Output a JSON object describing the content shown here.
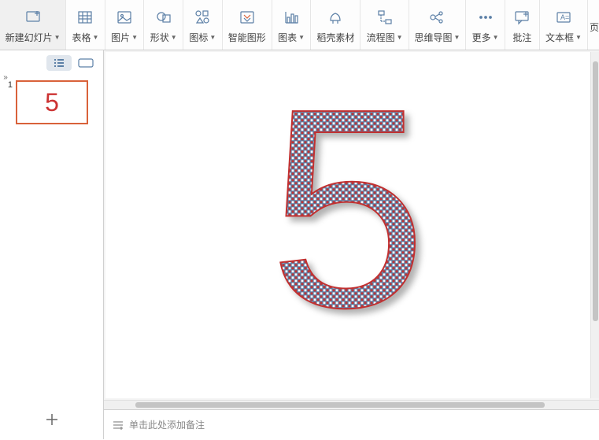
{
  "toolbar": {
    "items": [
      {
        "label": "新建幻灯片",
        "dropdown": true
      },
      {
        "label": "表格",
        "dropdown": true
      },
      {
        "label": "图片",
        "dropdown": true
      },
      {
        "label": "形状",
        "dropdown": true
      },
      {
        "label": "图标",
        "dropdown": true
      },
      {
        "label": "智能图形",
        "dropdown": false
      },
      {
        "label": "图表",
        "dropdown": true
      },
      {
        "label": "稻壳素材",
        "dropdown": false
      },
      {
        "label": "流程图",
        "dropdown": true
      },
      {
        "label": "思维导图",
        "dropdown": true
      },
      {
        "label": "更多",
        "dropdown": true
      },
      {
        "label": "批注",
        "dropdown": false
      },
      {
        "label": "文本框",
        "dropdown": true
      },
      {
        "label": "页",
        "dropdown": false
      }
    ]
  },
  "sidebar": {
    "collapse_icon": "»",
    "slides": [
      {
        "index": "1",
        "content": "5"
      }
    ]
  },
  "canvas": {
    "big_text": "5"
  },
  "notes": {
    "placeholder": "单击此处添加备注"
  }
}
